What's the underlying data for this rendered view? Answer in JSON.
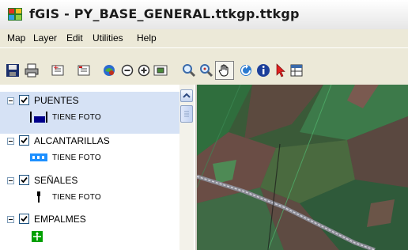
{
  "window": {
    "title": "fGIS - PY_BASE_GENERAL.ttkgp.ttkgp",
    "icon": "fgis-app-icon"
  },
  "menu": {
    "items": [
      "Map",
      "Layer",
      "Edit",
      "Utilities",
      "Help"
    ]
  },
  "toolbar": {
    "buttons": [
      "save-icon",
      "print-icon",
      "add-layer-icon",
      "remove-layer-icon",
      "zoom-full-extent-icon",
      "zoom-out-icon",
      "zoom-in-icon",
      "zoom-box-icon",
      "zoom-in-magnifier-icon",
      "zoom-out-magnifier-icon",
      "pan-hand-icon",
      "refresh-icon",
      "info-icon",
      "select-arrow-icon",
      "table-icon"
    ]
  },
  "layers": [
    {
      "name": "PUENTES",
      "checked": true,
      "selected": true,
      "legend_label": "TIENE FOTO",
      "legend_color": "#00008b"
    },
    {
      "name": "ALCANTARILLAS",
      "checked": true,
      "selected": false,
      "legend_label": "TIENE FOTO",
      "legend_color": "#1e90ff"
    },
    {
      "name": "SEÑALES",
      "checked": true,
      "selected": false,
      "legend_label": "TIENE FOTO",
      "legend_color": "#000000"
    },
    {
      "name": "EMPALMES",
      "checked": true,
      "selected": false,
      "legend_label": "",
      "legend_color": "#00c000"
    }
  ],
  "colors": {
    "selection": "#d6e2f5",
    "map_base": "#3a5a38",
    "road": "#8c8c96"
  }
}
